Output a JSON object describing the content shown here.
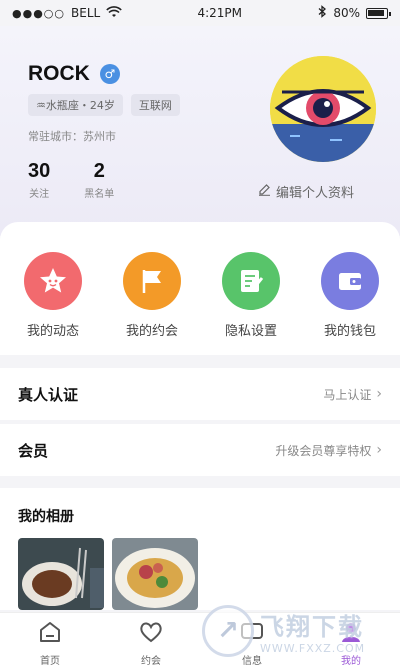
{
  "status_bar": {
    "carrier": "BELL",
    "signal": "●●●○○",
    "time": "4:21PM",
    "battery": "80%"
  },
  "profile": {
    "name": "ROCK",
    "gender_symbol": "♂",
    "tags": [
      "♒水瓶座・24岁",
      "互联网"
    ],
    "city": "常驻城市：苏州市",
    "stats": [
      {
        "value": "30",
        "label": "关注"
      },
      {
        "value": "2",
        "label": "黑名单"
      }
    ],
    "edit_label": "编辑个人资料"
  },
  "shortcuts": [
    {
      "label": "我的动态",
      "icon": "star-face-icon",
      "color": "#f26a6e"
    },
    {
      "label": "我的约会",
      "icon": "flag-icon",
      "color": "#f39a28"
    },
    {
      "label": "隐私设置",
      "icon": "edit-note-icon",
      "color": "#58c46a"
    },
    {
      "label": "我的钱包",
      "icon": "wallet-icon",
      "color": "#7a7de0"
    }
  ],
  "rows": [
    {
      "title": "真人认证",
      "action": "马上认证"
    },
    {
      "title": "会员",
      "action": "升级会员尊享特权"
    }
  ],
  "album": {
    "title": "我的相册"
  },
  "tabs": [
    {
      "label": "首页",
      "icon": "home-icon"
    },
    {
      "label": "约会",
      "icon": "heart-icon"
    },
    {
      "label": "信息",
      "icon": "message-icon"
    },
    {
      "label": "我的",
      "icon": "profile-icon"
    }
  ],
  "watermark": {
    "title": "飞翔下载",
    "url": "WWW.FXXZ.COM"
  }
}
